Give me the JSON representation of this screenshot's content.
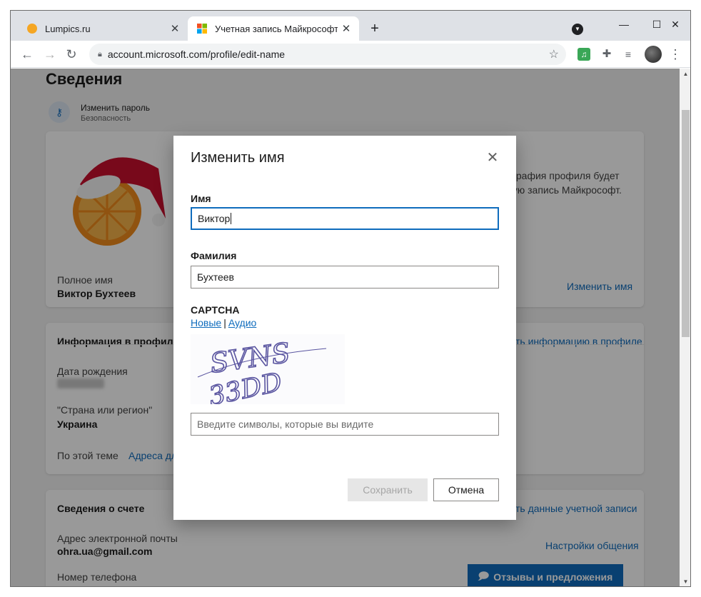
{
  "browser": {
    "tabs": [
      {
        "title": "Lumpics.ru",
        "close": "✕"
      },
      {
        "title": "Учетная запись Майкрософт | Уч",
        "close": "✕"
      }
    ],
    "new_tab": "+",
    "window_controls": {
      "minimize": "—",
      "maximize": "☐",
      "close": "✕"
    },
    "url": "account.microsoft.com/profile/edit-name",
    "nav": {
      "back": "←",
      "forward": "→",
      "reload": "↻"
    },
    "colors": {
      "tabstrip": "#dee1e6",
      "accent": "#0f6cbd"
    }
  },
  "page": {
    "heading": "Сведения",
    "password": {
      "title": "Изменить пароль",
      "subtitle": "Безопасность"
    },
    "profile_card": {
      "photo_text": "ография профиля будет",
      "photo_text2": "ную запись Майкрософт.",
      "full_name_label": "Полное имя",
      "full_name_value": "Виктор Бухтеев",
      "edit_name_link": "Изменить имя"
    },
    "info_card": {
      "header": "Информация в профиле",
      "edit_link": "ть информацию в профиле",
      "birth_label": "Дата рождения",
      "country_label": "\"Страна или регион\"",
      "country_value": "Украина",
      "topic_label": "По этой теме",
      "topic_link": "Адреса дл"
    },
    "account_card": {
      "header": "Сведения о счете",
      "edit_link": "ть данные учетной записи",
      "email_label": "Адрес электронной почты",
      "email_value": "ohra.ua@gmail.com",
      "comm_link": "Настройки общения",
      "phone_label": "Номер телефона"
    },
    "feedback_button": "Отзывы и предложения"
  },
  "dialog": {
    "title": "Изменить имя",
    "first_name_label": "Имя",
    "first_name_value": "Виктор",
    "last_name_label": "Фамилия",
    "last_name_value": "Бухтеев",
    "captcha_label": "CAPTCHA",
    "captcha_new": "Новые",
    "captcha_audio": "Аудио",
    "captcha_text_line1": "SVNS",
    "captcha_text_line2": "33DD",
    "captcha_placeholder": "Введите символы, которые вы видите",
    "save_button": "Сохранить",
    "cancel_button": "Отмена"
  }
}
